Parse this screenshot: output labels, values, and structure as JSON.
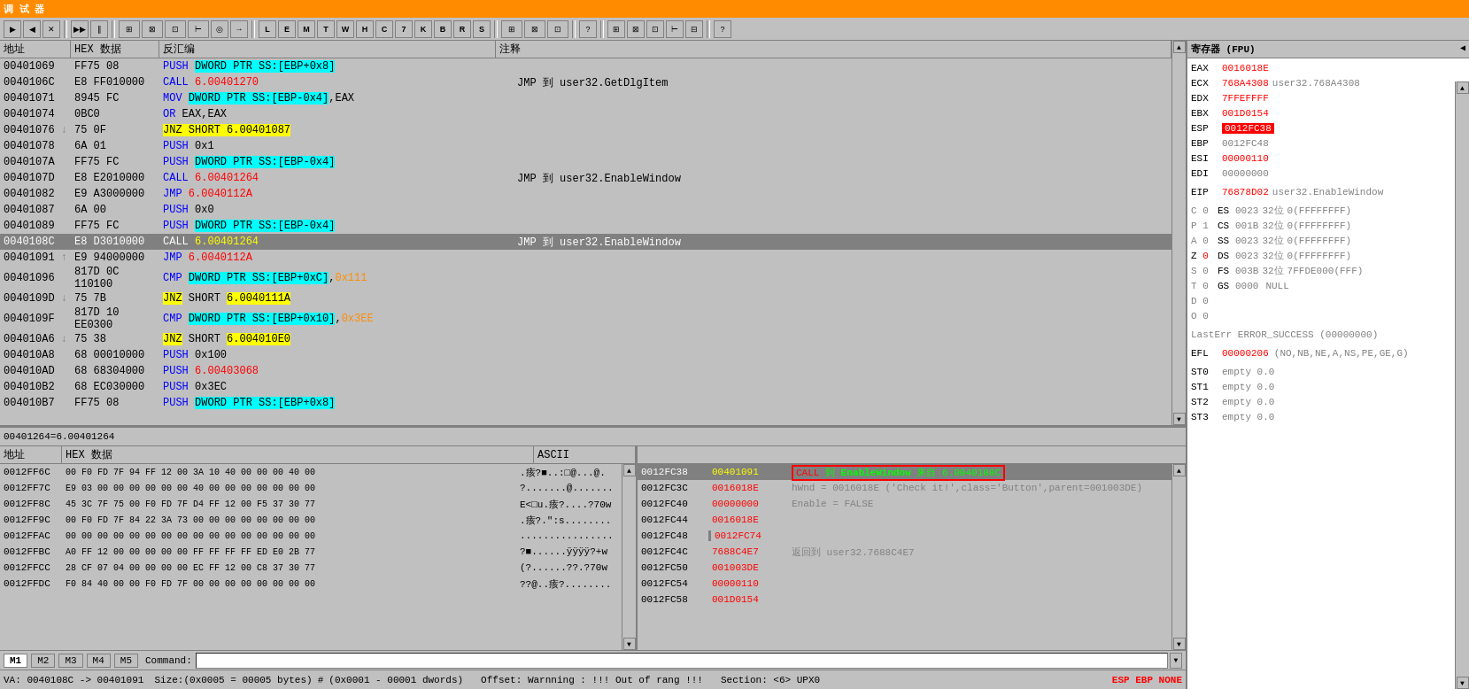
{
  "titlebar": {
    "text": "调 试 器"
  },
  "toolbar": {
    "buttons": [
      "▶",
      "■",
      "✕",
      "▶▶",
      "‖",
      "⚙",
      "⚙",
      "⊞",
      "⊠",
      "⊡",
      "⊢",
      "◎",
      "→",
      "L",
      "E",
      "M",
      "T",
      "W",
      "H",
      "C",
      "7",
      "K",
      "B",
      "R",
      "S",
      "⬛",
      "⬛",
      "⬛",
      "?",
      "⊞",
      "⊠",
      "⊡",
      "⊢",
      "⊟",
      "⬛",
      "?"
    ]
  },
  "disasm": {
    "headers": [
      "地址",
      "HEX 数据",
      "反汇编",
      "注释"
    ],
    "rows": [
      {
        "addr": "00401069",
        "hex": "FF75 08",
        "instr": "PUSH DWORD PTR SS:[EBP+0x8]",
        "instr_type": "push",
        "comment": ""
      },
      {
        "addr": "0040106C",
        "hex": "E8 FF010000",
        "instr": "CALL 6.00401270",
        "instr_type": "call",
        "comment": "JMP 到 user32.GetDlgItem"
      },
      {
        "addr": "00401071",
        "hex": "8945 FC",
        "instr": "MOV DWORD PTR SS:[EBP-0x4],EAX",
        "instr_type": "mov",
        "comment": ""
      },
      {
        "addr": "00401074",
        "hex": "0BC0",
        "instr": "OR EAX,EAX",
        "instr_type": "or",
        "comment": ""
      },
      {
        "addr": "00401076",
        "hex": "75 0F",
        "instr": "JNZ SHORT 6.00401087",
        "instr_type": "jnz",
        "comment": ""
      },
      {
        "addr": "00401078",
        "hex": "6A 01",
        "instr": "PUSH 0x1",
        "instr_type": "push",
        "comment": ""
      },
      {
        "addr": "0040107A",
        "hex": "FF75 FC",
        "instr": "PUSH DWORD PTR SS:[EBP-0x4]",
        "instr_type": "push",
        "comment": ""
      },
      {
        "addr": "0040107D",
        "hex": "E8 E2010000",
        "instr": "CALL 6.00401264",
        "instr_type": "call",
        "comment": "JMP 到 user32.EnableWindow"
      },
      {
        "addr": "00401082",
        "hex": "E9 A3000000",
        "instr": "JMP 6.0040112A",
        "instr_type": "jmp",
        "comment": ""
      },
      {
        "addr": "00401087",
        "hex": "6A 00",
        "instr": "PUSH 0x0",
        "instr_type": "push",
        "comment": ""
      },
      {
        "addr": "00401089",
        "hex": "FF75 FC",
        "instr": "PUSH DWORD PTR SS:[EBP-0x4]",
        "instr_type": "push",
        "comment": ""
      },
      {
        "addr": "0040108C",
        "hex": "E8 D3010000",
        "instr": "CALL 6.00401264",
        "instr_type": "call",
        "comment": "JMP 到 user32.EnableWindow",
        "selected": true
      },
      {
        "addr": "00401091",
        "hex": "E9 94000000",
        "instr": "JMP 6.0040112A",
        "instr_type": "jmp",
        "comment": ""
      },
      {
        "addr": "00401096",
        "hex": "817D 0C 110100",
        "instr": "CMP DWORD PTR SS:[EBP+0xC],0x111",
        "instr_type": "cmp",
        "comment": ""
      },
      {
        "addr": "0040109D",
        "hex": "75 7B",
        "instr": "JNZ SHORT 6.0040111A",
        "instr_type": "jnz",
        "comment": ""
      },
      {
        "addr": "0040109F",
        "hex": "817D 10 EE0300",
        "instr": "CMP DWORD PTR SS:[EBP+0x10],0x3EE",
        "instr_type": "cmp",
        "comment": ""
      },
      {
        "addr": "004010A6",
        "hex": "75 38",
        "instr": "JNZ SHORT 6.004010E0",
        "instr_type": "jnz",
        "comment": ""
      },
      {
        "addr": "004010A8",
        "hex": "68 00010000",
        "instr": "PUSH 0x100",
        "instr_type": "push",
        "comment": ""
      },
      {
        "addr": "004010AD",
        "hex": "68 68304000",
        "instr": "PUSH 6.00403068",
        "instr_type": "push",
        "comment": ""
      },
      {
        "addr": "004010B2",
        "hex": "68 EC030000",
        "instr": "PUSH 0x3EC",
        "instr_type": "push",
        "comment": ""
      },
      {
        "addr": "004010B7",
        "hex": "FF75 08",
        "instr": "PUSH DWORD PTR SS:[EBP+0x8]",
        "instr_type": "push",
        "comment": ""
      }
    ],
    "info_label": "00401264=6.00401264"
  },
  "registers": {
    "header": "寄存器 (FPU)",
    "regs": [
      {
        "name": "EAX",
        "val": "0016018E",
        "comment": "",
        "highlight": false
      },
      {
        "name": "ECX",
        "val": "768A4308",
        "comment": "user32.768A4308",
        "highlight": false
      },
      {
        "name": "EDX",
        "val": "7FFEFFFF",
        "comment": "",
        "highlight": false
      },
      {
        "name": "EBX",
        "val": "001D0154",
        "comment": "",
        "highlight": false
      },
      {
        "name": "ESP",
        "val": "0012FC38",
        "comment": "",
        "highlight": true
      },
      {
        "name": "EBP",
        "val": "0012FC48",
        "comment": "",
        "highlight": false
      },
      {
        "name": "ESI",
        "val": "00000110",
        "comment": "",
        "highlight": false
      },
      {
        "name": "EDI",
        "val": "00000000",
        "comment": "",
        "highlight": false
      },
      {
        "name": "EIP",
        "val": "76878D02",
        "comment": "user32.EnableWindow",
        "highlight": false
      }
    ],
    "flags": [
      {
        "prefix": "C 0",
        "items": [
          {
            "name": "ES",
            "val": "0023",
            "bits": "32位",
            "extra": "0(FFFFFFFF)"
          }
        ]
      },
      {
        "prefix": "P 1",
        "items": [
          {
            "name": "CS",
            "val": "001B",
            "bits": "32位",
            "extra": "0(FFFFFFFF)"
          }
        ]
      },
      {
        "prefix": "A 0",
        "items": [
          {
            "name": "SS",
            "val": "0023",
            "bits": "32位",
            "extra": "0(FFFFFFFF)"
          }
        ]
      },
      {
        "prefix": "Z 0",
        "items": [
          {
            "name": "DS",
            "val": "0023",
            "bits": "32位",
            "extra": "0(FFFFFFFF)",
            "red": true
          }
        ]
      },
      {
        "prefix": "S 0",
        "items": [
          {
            "name": "FS",
            "val": "003B",
            "bits": "32位",
            "extra": "7FFDE000(FFF)"
          }
        ]
      },
      {
        "prefix": "T 0",
        "items": [
          {
            "name": "GS",
            "val": "0000",
            "bits": "",
            "extra": "NULL"
          }
        ]
      },
      {
        "prefix": "D 0",
        "items": []
      },
      {
        "prefix": "O 0",
        "items": []
      }
    ],
    "lasterr": "LastErr ERROR_SUCCESS (00000000)",
    "efl": {
      "val": "00000206",
      "comment": "(NO,NB,NE,A,NS,PE,GE,G)"
    },
    "st": [
      {
        "name": "ST0",
        "val": "empty 0.0"
      },
      {
        "name": "ST1",
        "val": "empty 0.0"
      },
      {
        "name": "ST2",
        "val": "empty 0.0"
      },
      {
        "name": "ST3",
        "val": "empty 0.0"
      }
    ]
  },
  "memory": {
    "headers": [
      "地址",
      "HEX 数据",
      "ASCII"
    ],
    "rows": [
      {
        "addr": "0012FF6C",
        "hex": "00 F0 FD 7F 94 FF 12 00 3A 10 40 00 00 00 40 00",
        "ascii": ".瘢?m.:⊞@...@."
      },
      {
        "addr": "0012FF7C",
        "hex": "E9 03 00 00 00 00 00 00 40 00 00 00 00 00 00 00",
        "ascii": "?......@......."
      },
      {
        "addr": "0012FF8C",
        "hex": "45 3C 7F 75 00 F0 FD 7F D4 FF 12 00 F5 37 30 77",
        "ascii": "E<u.瘢?....?70w"
      },
      {
        "addr": "0012FF9C",
        "hex": "00 F0 FD 7F 84 22 3A 73 00 00 00 00 00 00 00 00",
        "ascii": ".瘢?.\":s........"
      },
      {
        "addr": "0012FFAC",
        "hex": "00 00 00 00 00 00 00 00 00 00 00 00 00 00 00 00",
        "ascii": "................"
      },
      {
        "addr": "0012FFBC",
        "hex": "A0 FF 12 00 00 00 00 00 FF FF FF FF ED E0 2B 77",
        "ascii": "?m.......ÿÿÿ?+w"
      },
      {
        "addr": "0012FFCC",
        "hex": "28 CF 07 04 00 00 00 00 EC FF 12 00 C8 37 30 77",
        "ascii": "(?......??.?70w"
      },
      {
        "addr": "0012FFDC",
        "hex": "F0 84 40 00 00 F0 FD 7F 00 00 00 00 00 00 00 00",
        "ascii": "??@..瘢?........"
      }
    ]
  },
  "stack": {
    "rows": [
      {
        "addr": "0012FC38",
        "val": "00401091",
        "comment": "CALL 到 EnableWindow 来自 6.0040108C",
        "selected": true
      },
      {
        "addr": "0012FC3C",
        "val": "0016018E",
        "comment": "hWnd = 0016018E ('Check it!',class='Button',parent=001003DE)"
      },
      {
        "addr": "0012FC40",
        "val": "00000000",
        "comment": "Enable = FALSE"
      },
      {
        "addr": "0012FC44",
        "val": "0016018E",
        "comment": ""
      },
      {
        "addr": "0012FC48",
        "val": "0012FC74",
        "comment": ""
      },
      {
        "addr": "0012FC4C",
        "val": "7688C4E7",
        "comment": "返回到 user32.7688C4E7"
      },
      {
        "addr": "0012FC50",
        "val": "001003DE",
        "comment": ""
      },
      {
        "addr": "0012FC54",
        "val": "00000110",
        "comment": ""
      },
      {
        "addr": "0012FC58",
        "val": "001D0154",
        "comment": ""
      }
    ]
  },
  "statusbar": {
    "va": "VA: 0040108C -> 00401091",
    "size": "Size:(0x0005 = 00005 bytes)",
    "hash": "#",
    "offset": "(0x0001 - 00001 dwords)",
    "warning": "Offset: Warnning : !!! Out of rang !!!",
    "section": "Section: <6> UPX0",
    "right": "ESP  EBP  NONE"
  },
  "commandbar": {
    "tabs": [
      "M1",
      "M2",
      "M3",
      "M4",
      "M5"
    ],
    "active_tab": "M1",
    "label": "Command:",
    "value": ""
  }
}
